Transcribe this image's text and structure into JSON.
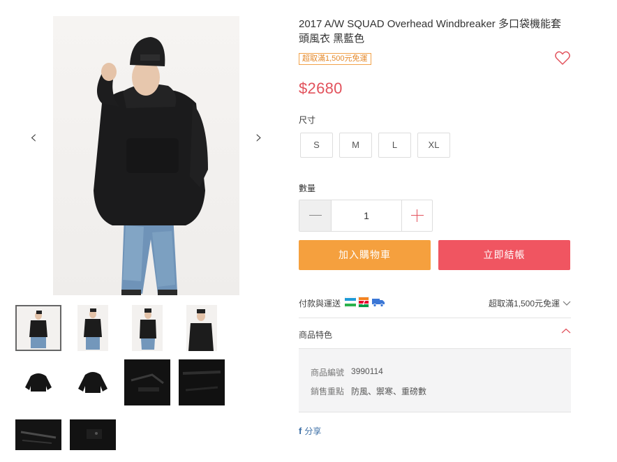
{
  "product": {
    "title": "2017 A/W SQUAD Overhead Windbreaker 多口袋機能套頭風衣 黑藍色",
    "promo_badge": "超取滿1,500元免運",
    "price": "$2680"
  },
  "gallery": {
    "thumbnail_count": 10,
    "selected_index": 0
  },
  "size": {
    "label": "尺寸",
    "options": [
      "S",
      "M",
      "L",
      "XL"
    ]
  },
  "quantity": {
    "label": "數量",
    "value": "1"
  },
  "actions": {
    "add_to_cart": "加入購物車",
    "checkout": "立即結帳"
  },
  "shipping": {
    "label": "付款與運送",
    "summary": "超取滿1,500元免運"
  },
  "features": {
    "title": "商品特色",
    "specs": [
      {
        "key": "商品編號",
        "value": "3990114"
      },
      {
        "key": "銷售重點",
        "value": "防風、禦寒、重磅數"
      }
    ]
  },
  "share": {
    "label": "分享"
  },
  "colors": {
    "price_red": "#e2525c",
    "cart_orange": "#f5a03e",
    "checkout_red": "#f05561",
    "badge_orange": "#e4892b"
  }
}
